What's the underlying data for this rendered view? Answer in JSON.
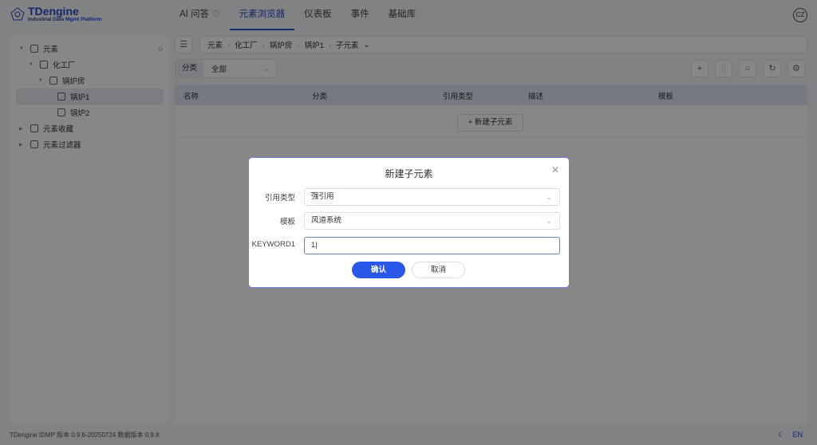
{
  "header": {
    "brand": "TDengine",
    "subtitle": "Industrial Data Mgmt Platform",
    "nav": [
      "AI 问答",
      "元素浏览器",
      "仪表板",
      "事件",
      "基础库"
    ],
    "active_nav": "元素浏览器",
    "avatar": "CZ"
  },
  "tree": {
    "items": [
      {
        "label": "元素"
      },
      {
        "label": "化工厂"
      },
      {
        "label": "锅炉房"
      },
      {
        "label": "锅炉1"
      },
      {
        "label": "锅炉2"
      },
      {
        "label": "元素收藏"
      },
      {
        "label": "元素过滤器"
      }
    ]
  },
  "breadcrumb": [
    "元素",
    "化工厂",
    "锅炉房",
    "锅炉1",
    "子元素"
  ],
  "filter": {
    "label": "分类",
    "value": "全部"
  },
  "table": {
    "columns": [
      "名称",
      "分类",
      "引用类型",
      "描述",
      "模板"
    ],
    "new_button": "新建子元素"
  },
  "footer": {
    "version": "TDengine IDMP 版本 0.9.8-20250724 数据版本 0.9.8",
    "lang": "EN"
  },
  "modal": {
    "title": "新建子元素",
    "fields": [
      {
        "label": "引用类型",
        "value": "强引用"
      },
      {
        "label": "模板",
        "value": "风道系统"
      },
      {
        "label": "KEYWORD1",
        "value": "1"
      }
    ],
    "ok": "确认",
    "cancel": "取消"
  }
}
